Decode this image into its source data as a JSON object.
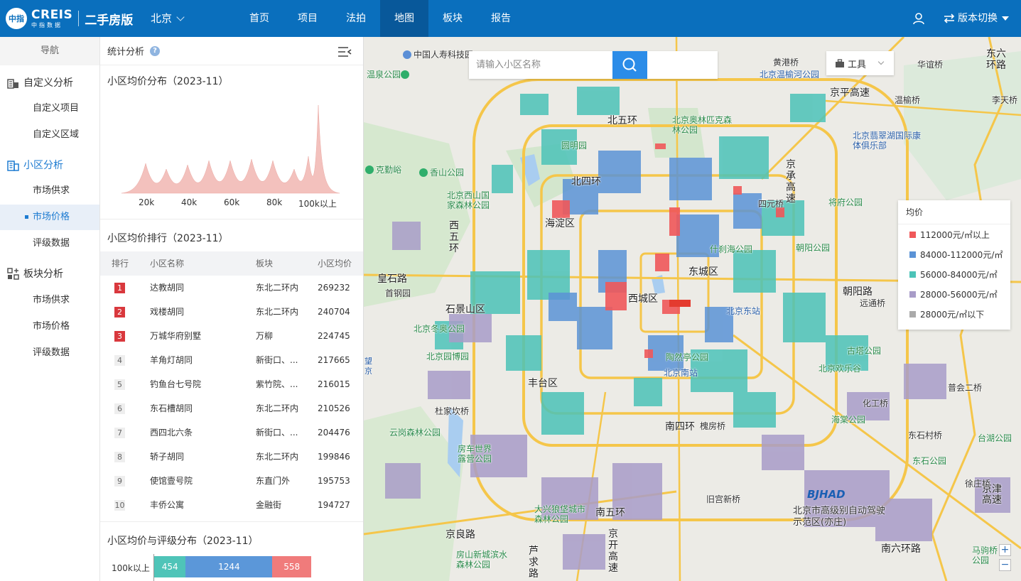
{
  "header": {
    "logo_badge": "中指",
    "logo_main": "CREIS",
    "logo_sub": "中指数据",
    "product": "二手房版",
    "city": "北京",
    "nav": [
      "首页",
      "项目",
      "法拍",
      "地图",
      "板块",
      "报告"
    ],
    "nav_active": "地图",
    "version_label": "版本切换",
    "colors": {
      "primary": "#0a6fbd",
      "active_nav": "#08589a"
    }
  },
  "sidebar": {
    "title": "导航",
    "groups": [
      {
        "label": "自定义分析",
        "icon": "building-chart-icon",
        "items": [
          "自定义项目",
          "自定义区域"
        ]
      },
      {
        "label": "小区分析",
        "icon": "building-icon",
        "items": [
          "市场供求",
          "市场价格",
          "评级数据"
        ]
      },
      {
        "label": "板块分析",
        "icon": "grid-plus-icon",
        "items": [
          "市场供求",
          "市场价格",
          "评级数据"
        ]
      }
    ],
    "active_group": "小区分析",
    "active_item": "市场价格"
  },
  "panel": {
    "title": "统计分析",
    "distribution": {
      "title": "小区均价分布（2023-11）",
      "ticks": [
        "20k",
        "40k",
        "60k",
        "80k",
        "100k以上"
      ],
      "color": "#f0b1ad"
    },
    "ranking": {
      "title": "小区均价排行（2023-11）",
      "columns": [
        "排行",
        "小区名称",
        "板块",
        "小区均价"
      ],
      "rows": [
        {
          "rank": "1",
          "name": "达教胡同",
          "block": "东北二环内",
          "price": "269232"
        },
        {
          "rank": "2",
          "name": "戏楼胡同",
          "block": "东北二环内",
          "price": "240704"
        },
        {
          "rank": "3",
          "name": "万城华府别墅",
          "block": "万柳",
          "price": "224745"
        },
        {
          "rank": "4",
          "name": "羊角灯胡同",
          "block": "新街口、...",
          "price": "217665"
        },
        {
          "rank": "5",
          "name": "钓鱼台七号院",
          "block": "紫竹院、...",
          "price": "216015"
        },
        {
          "rank": "6",
          "name": "东石槽胡同",
          "block": "东北二环内",
          "price": "210526"
        },
        {
          "rank": "7",
          "name": "西四北六条",
          "block": "新街口、...",
          "price": "204476"
        },
        {
          "rank": "8",
          "name": "轿子胡同",
          "block": "东北二环内",
          "price": "199846"
        },
        {
          "rank": "9",
          "name": "使馆壹号院",
          "block": "东直门外",
          "price": "195753"
        },
        {
          "rank": "10",
          "name": "丰侨公寓",
          "block": "金融街",
          "price": "194727"
        }
      ]
    },
    "rating": {
      "title": "小区均价与评级分布（2023-11）",
      "row_label": "100k以上",
      "segments": [
        {
          "value": 454,
          "label": "454",
          "color": "#4fc4b8"
        },
        {
          "value": 1244,
          "label": "1244",
          "color": "#5b97d9"
        },
        {
          "value": 558,
          "label": "558",
          "color": "#f07b7b"
        }
      ]
    }
  },
  "map": {
    "search_placeholder": "请输入小区名称",
    "tools_label": "工具",
    "legend": {
      "title": "均价",
      "items": [
        {
          "label": "112000元/㎡以上",
          "color": "#f0585a"
        },
        {
          "label": "84000-112000元/㎡",
          "color": "#5b93d6"
        },
        {
          "label": "56000-84000元/㎡",
          "color": "#4cc3b8"
        },
        {
          "label": "28000-56000元/㎡",
          "color": "#a89cc8"
        },
        {
          "label": "28000元/㎡以下",
          "color": "#aaaaaa"
        }
      ]
    },
    "zoom_in": "+",
    "zoom_out": "−",
    "labels": {
      "l1": "中国人寿科技园",
      "l2": "温泉公园",
      "l3": "黄港桥",
      "l4": "北京温榆河公园",
      "l5": "华谊桥",
      "l6": "东六环路",
      "l7": "京平高速",
      "l8": "温榆桥",
      "l9": "李天桥",
      "l10": "北五环",
      "l11": "北京奥林匹克森林公园",
      "l12": "圆明园",
      "l13": "北京翡翠湖国际康体俱乐部",
      "l14": "克勤峪",
      "l15": "香山公园",
      "l16": "北四环",
      "l17": "京承高速",
      "l18": "四元桥",
      "l19": "将府公园",
      "l20": "北京西山国家森林公园",
      "l21": "海淀区",
      "l22": "什刹海公园",
      "l23": "朝阳公园",
      "l24": "西五环",
      "l25": "东城区",
      "l26": "皇石路",
      "l27": "首钢园",
      "l28": "西城区",
      "l29": "朝阳路",
      "l30": "远通桥",
      "l31": "石景山区",
      "l32": "北京东站",
      "l33": "北京冬奥公园",
      "l34": "古塔公园",
      "l35": "北京园博园",
      "l36": "陶然亭公园",
      "l37": "北京南站",
      "l38": "北京欢乐谷",
      "l39": "丰台区",
      "l40": "普会二桥",
      "l41": "杜家坎桥",
      "l42": "化工桥",
      "l43": "南四环",
      "l44": "槐房桥",
      "l45": "海棠公园",
      "l46": "云岗森林公园",
      "l47": "房车世界露营公园",
      "l48": "东石村桥",
      "l49": "台湖公园",
      "l50": "东石公园",
      "l51": "徐庄桥",
      "l52": "旧宫新桥",
      "l53": "北京市高级别自动驾驶示范区(亦庄)",
      "l54": "京津高速",
      "l55": "大兴狼垡城市森林公园",
      "l56": "南五环",
      "l57": "京良路",
      "l58": "京开高速",
      "l59": "房山新城滨水森林公园",
      "l60": "芦求路",
      "l61": "南六环路",
      "l62": "马驹桥公园",
      "l63": "望京"
    },
    "bjhad_logo": "BJHAD"
  }
}
